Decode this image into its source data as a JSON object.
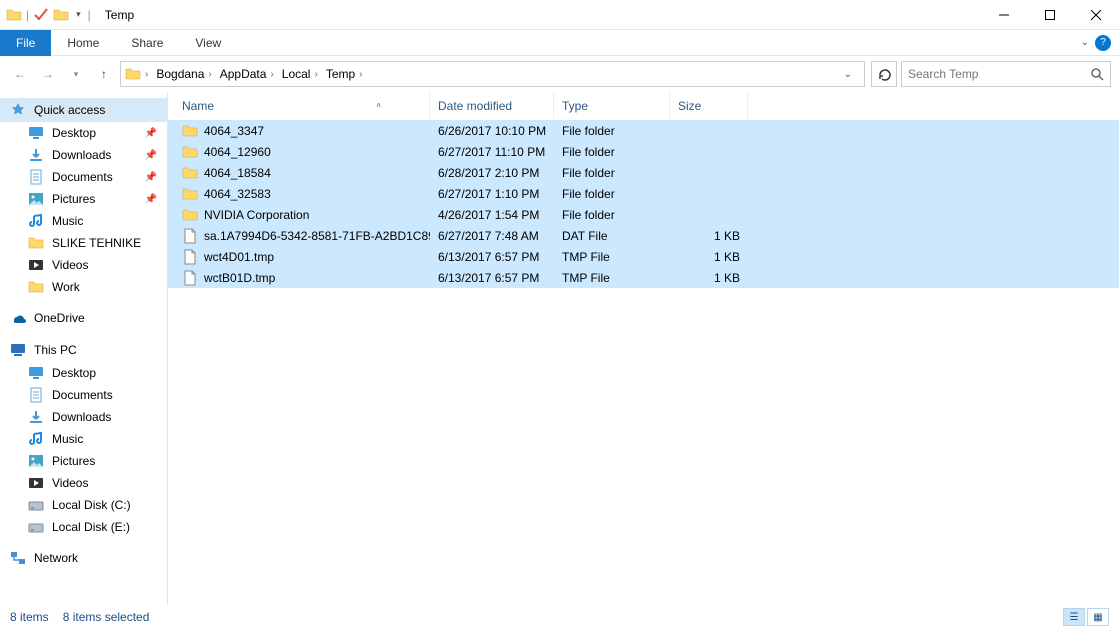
{
  "window": {
    "title": "Temp"
  },
  "ribbon": {
    "file": "File",
    "tabs": [
      "Home",
      "Share",
      "View"
    ]
  },
  "breadcrumb": [
    "Bogdana",
    "AppData",
    "Local",
    "Temp"
  ],
  "search": {
    "placeholder": "Search Temp"
  },
  "sidebar": {
    "quick_access": {
      "label": "Quick access",
      "items": [
        {
          "label": "Desktop",
          "pin": true,
          "icon": "desktop"
        },
        {
          "label": "Downloads",
          "pin": true,
          "icon": "downloads"
        },
        {
          "label": "Documents",
          "pin": true,
          "icon": "documents"
        },
        {
          "label": "Pictures",
          "pin": true,
          "icon": "pictures"
        },
        {
          "label": "Music",
          "pin": false,
          "icon": "music"
        },
        {
          "label": "SLIKE TEHNIKE",
          "pin": false,
          "icon": "folder"
        },
        {
          "label": "Videos",
          "pin": false,
          "icon": "videos"
        },
        {
          "label": "Work",
          "pin": false,
          "icon": "folder"
        }
      ]
    },
    "onedrive": {
      "label": "OneDrive"
    },
    "this_pc": {
      "label": "This PC",
      "items": [
        {
          "label": "Desktop",
          "icon": "desktop"
        },
        {
          "label": "Documents",
          "icon": "documents"
        },
        {
          "label": "Downloads",
          "icon": "downloads"
        },
        {
          "label": "Music",
          "icon": "music"
        },
        {
          "label": "Pictures",
          "icon": "pictures"
        },
        {
          "label": "Videos",
          "icon": "videos"
        },
        {
          "label": "Local Disk (C:)",
          "icon": "disk"
        },
        {
          "label": "Local Disk (E:)",
          "icon": "disk"
        }
      ]
    },
    "network": {
      "label": "Network"
    }
  },
  "columns": {
    "name": "Name",
    "date": "Date modified",
    "type": "Type",
    "size": "Size"
  },
  "files": [
    {
      "name": "4064_3347",
      "date": "6/26/2017 10:10 PM",
      "type": "File folder",
      "size": "",
      "icon": "folder"
    },
    {
      "name": "4064_12960",
      "date": "6/27/2017 11:10 PM",
      "type": "File folder",
      "size": "",
      "icon": "folder"
    },
    {
      "name": "4064_18584",
      "date": "6/28/2017 2:10 PM",
      "type": "File folder",
      "size": "",
      "icon": "folder"
    },
    {
      "name": "4064_32583",
      "date": "6/27/2017 1:10 PM",
      "type": "File folder",
      "size": "",
      "icon": "folder"
    },
    {
      "name": "NVIDIA Corporation",
      "date": "4/26/2017 1:54 PM",
      "type": "File folder",
      "size": "",
      "icon": "folder"
    },
    {
      "name": "sa.1A7994D6-5342-8581-71FB-A2BD1C89…",
      "date": "6/27/2017 7:48 AM",
      "type": "DAT File",
      "size": "1 KB",
      "icon": "file"
    },
    {
      "name": "wct4D01.tmp",
      "date": "6/13/2017 6:57 PM",
      "type": "TMP File",
      "size": "1 KB",
      "icon": "file"
    },
    {
      "name": "wctB01D.tmp",
      "date": "6/13/2017 6:57 PM",
      "type": "TMP File",
      "size": "1 KB",
      "icon": "file"
    }
  ],
  "status": {
    "count": "8 items",
    "selected": "8 items selected"
  }
}
